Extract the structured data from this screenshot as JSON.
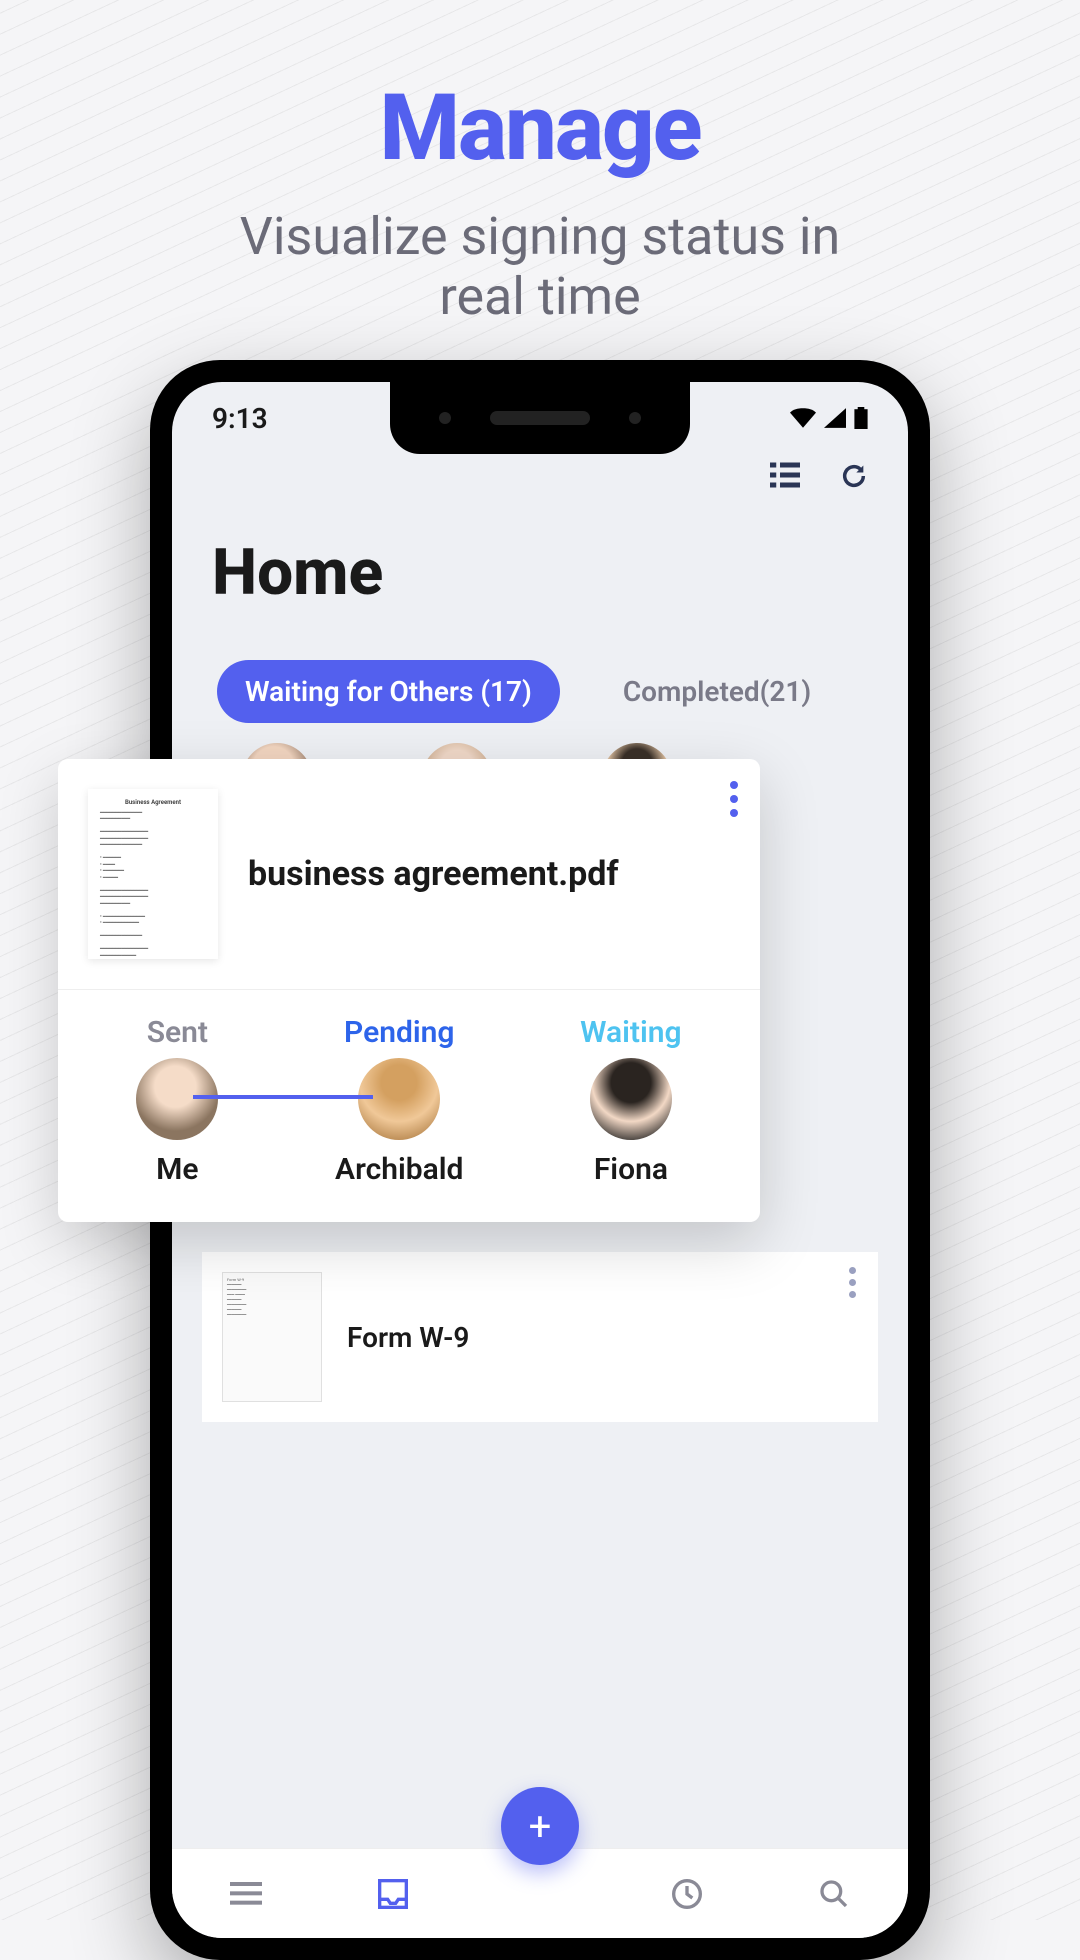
{
  "hero": {
    "title": "Manage",
    "subtitle_line1": "Visualize signing status in",
    "subtitle_line2": "real time"
  },
  "status": {
    "time": "9:13"
  },
  "app": {
    "page_title": "Home",
    "tabs": [
      {
        "label": "Waiting for Others (17)"
      },
      {
        "label": "Completed(21)"
      }
    ]
  },
  "floating": {
    "doc_name": "business agreement.pdf",
    "thumb_title": "Business Agreement",
    "signers": [
      {
        "status_label": "Sent",
        "name": "Me"
      },
      {
        "status_label": "Pending",
        "name": "Archibald"
      },
      {
        "status_label": "Waiting",
        "name": "Fiona"
      }
    ]
  },
  "below": {
    "doc_name": "Form W-9"
  },
  "fab": {
    "glyph": "+"
  },
  "colors": {
    "accent": "#5360ee",
    "pending": "#2d64ea",
    "waiting": "#4ec3f0"
  }
}
